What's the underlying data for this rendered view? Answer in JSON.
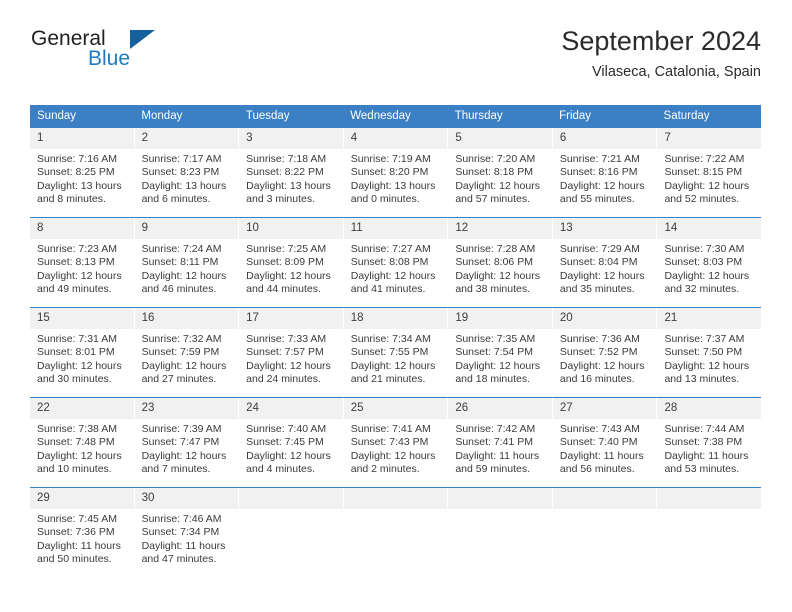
{
  "brand": {
    "name_top": "General",
    "name_bottom": "Blue",
    "accent_color": "#1d7cc4",
    "triangle_color": "#17609e",
    "logo_icon": "triangle-icon"
  },
  "header": {
    "title": "September 2024",
    "subtitle": "Vilaseca, Catalonia, Spain"
  },
  "calendar": {
    "header_bg_color": "#3b7fc4",
    "day_number_bg_color": "#f1f1f1",
    "weekdays": [
      "Sunday",
      "Monday",
      "Tuesday",
      "Wednesday",
      "Thursday",
      "Friday",
      "Saturday"
    ],
    "weeks": [
      [
        {
          "date": "1",
          "sunrise": "Sunrise: 7:16 AM",
          "sunset": "Sunset: 8:25 PM",
          "daylight_line1": "Daylight: 13 hours",
          "daylight_line2": "and 8 minutes."
        },
        {
          "date": "2",
          "sunrise": "Sunrise: 7:17 AM",
          "sunset": "Sunset: 8:23 PM",
          "daylight_line1": "Daylight: 13 hours",
          "daylight_line2": "and 6 minutes."
        },
        {
          "date": "3",
          "sunrise": "Sunrise: 7:18 AM",
          "sunset": "Sunset: 8:22 PM",
          "daylight_line1": "Daylight: 13 hours",
          "daylight_line2": "and 3 minutes."
        },
        {
          "date": "4",
          "sunrise": "Sunrise: 7:19 AM",
          "sunset": "Sunset: 8:20 PM",
          "daylight_line1": "Daylight: 13 hours",
          "daylight_line2": "and 0 minutes."
        },
        {
          "date": "5",
          "sunrise": "Sunrise: 7:20 AM",
          "sunset": "Sunset: 8:18 PM",
          "daylight_line1": "Daylight: 12 hours",
          "daylight_line2": "and 57 minutes."
        },
        {
          "date": "6",
          "sunrise": "Sunrise: 7:21 AM",
          "sunset": "Sunset: 8:16 PM",
          "daylight_line1": "Daylight: 12 hours",
          "daylight_line2": "and 55 minutes."
        },
        {
          "date": "7",
          "sunrise": "Sunrise: 7:22 AM",
          "sunset": "Sunset: 8:15 PM",
          "daylight_line1": "Daylight: 12 hours",
          "daylight_line2": "and 52 minutes."
        }
      ],
      [
        {
          "date": "8",
          "sunrise": "Sunrise: 7:23 AM",
          "sunset": "Sunset: 8:13 PM",
          "daylight_line1": "Daylight: 12 hours",
          "daylight_line2": "and 49 minutes."
        },
        {
          "date": "9",
          "sunrise": "Sunrise: 7:24 AM",
          "sunset": "Sunset: 8:11 PM",
          "daylight_line1": "Daylight: 12 hours",
          "daylight_line2": "and 46 minutes."
        },
        {
          "date": "10",
          "sunrise": "Sunrise: 7:25 AM",
          "sunset": "Sunset: 8:09 PM",
          "daylight_line1": "Daylight: 12 hours",
          "daylight_line2": "and 44 minutes."
        },
        {
          "date": "11",
          "sunrise": "Sunrise: 7:27 AM",
          "sunset": "Sunset: 8:08 PM",
          "daylight_line1": "Daylight: 12 hours",
          "daylight_line2": "and 41 minutes."
        },
        {
          "date": "12",
          "sunrise": "Sunrise: 7:28 AM",
          "sunset": "Sunset: 8:06 PM",
          "daylight_line1": "Daylight: 12 hours",
          "daylight_line2": "and 38 minutes."
        },
        {
          "date": "13",
          "sunrise": "Sunrise: 7:29 AM",
          "sunset": "Sunset: 8:04 PM",
          "daylight_line1": "Daylight: 12 hours",
          "daylight_line2": "and 35 minutes."
        },
        {
          "date": "14",
          "sunrise": "Sunrise: 7:30 AM",
          "sunset": "Sunset: 8:03 PM",
          "daylight_line1": "Daylight: 12 hours",
          "daylight_line2": "and 32 minutes."
        }
      ],
      [
        {
          "date": "15",
          "sunrise": "Sunrise: 7:31 AM",
          "sunset": "Sunset: 8:01 PM",
          "daylight_line1": "Daylight: 12 hours",
          "daylight_line2": "and 30 minutes."
        },
        {
          "date": "16",
          "sunrise": "Sunrise: 7:32 AM",
          "sunset": "Sunset: 7:59 PM",
          "daylight_line1": "Daylight: 12 hours",
          "daylight_line2": "and 27 minutes."
        },
        {
          "date": "17",
          "sunrise": "Sunrise: 7:33 AM",
          "sunset": "Sunset: 7:57 PM",
          "daylight_line1": "Daylight: 12 hours",
          "daylight_line2": "and 24 minutes."
        },
        {
          "date": "18",
          "sunrise": "Sunrise: 7:34 AM",
          "sunset": "Sunset: 7:55 PM",
          "daylight_line1": "Daylight: 12 hours",
          "daylight_line2": "and 21 minutes."
        },
        {
          "date": "19",
          "sunrise": "Sunrise: 7:35 AM",
          "sunset": "Sunset: 7:54 PM",
          "daylight_line1": "Daylight: 12 hours",
          "daylight_line2": "and 18 minutes."
        },
        {
          "date": "20",
          "sunrise": "Sunrise: 7:36 AM",
          "sunset": "Sunset: 7:52 PM",
          "daylight_line1": "Daylight: 12 hours",
          "daylight_line2": "and 16 minutes."
        },
        {
          "date": "21",
          "sunrise": "Sunrise: 7:37 AM",
          "sunset": "Sunset: 7:50 PM",
          "daylight_line1": "Daylight: 12 hours",
          "daylight_line2": "and 13 minutes."
        }
      ],
      [
        {
          "date": "22",
          "sunrise": "Sunrise: 7:38 AM",
          "sunset": "Sunset: 7:48 PM",
          "daylight_line1": "Daylight: 12 hours",
          "daylight_line2": "and 10 minutes."
        },
        {
          "date": "23",
          "sunrise": "Sunrise: 7:39 AM",
          "sunset": "Sunset: 7:47 PM",
          "daylight_line1": "Daylight: 12 hours",
          "daylight_line2": "and 7 minutes."
        },
        {
          "date": "24",
          "sunrise": "Sunrise: 7:40 AM",
          "sunset": "Sunset: 7:45 PM",
          "daylight_line1": "Daylight: 12 hours",
          "daylight_line2": "and 4 minutes."
        },
        {
          "date": "25",
          "sunrise": "Sunrise: 7:41 AM",
          "sunset": "Sunset: 7:43 PM",
          "daylight_line1": "Daylight: 12 hours",
          "daylight_line2": "and 2 minutes."
        },
        {
          "date": "26",
          "sunrise": "Sunrise: 7:42 AM",
          "sunset": "Sunset: 7:41 PM",
          "daylight_line1": "Daylight: 11 hours",
          "daylight_line2": "and 59 minutes."
        },
        {
          "date": "27",
          "sunrise": "Sunrise: 7:43 AM",
          "sunset": "Sunset: 7:40 PM",
          "daylight_line1": "Daylight: 11 hours",
          "daylight_line2": "and 56 minutes."
        },
        {
          "date": "28",
          "sunrise": "Sunrise: 7:44 AM",
          "sunset": "Sunset: 7:38 PM",
          "daylight_line1": "Daylight: 11 hours",
          "daylight_line2": "and 53 minutes."
        }
      ],
      [
        {
          "date": "29",
          "sunrise": "Sunrise: 7:45 AM",
          "sunset": "Sunset: 7:36 PM",
          "daylight_line1": "Daylight: 11 hours",
          "daylight_line2": "and 50 minutes."
        },
        {
          "date": "30",
          "sunrise": "Sunrise: 7:46 AM",
          "sunset": "Sunset: 7:34 PM",
          "daylight_line1": "Daylight: 11 hours",
          "daylight_line2": "and 47 minutes."
        },
        {
          "date": "",
          "sunrise": "",
          "sunset": "",
          "daylight_line1": "",
          "daylight_line2": ""
        },
        {
          "date": "",
          "sunrise": "",
          "sunset": "",
          "daylight_line1": "",
          "daylight_line2": ""
        },
        {
          "date": "",
          "sunrise": "",
          "sunset": "",
          "daylight_line1": "",
          "daylight_line2": ""
        },
        {
          "date": "",
          "sunrise": "",
          "sunset": "",
          "daylight_line1": "",
          "daylight_line2": ""
        },
        {
          "date": "",
          "sunrise": "",
          "sunset": "",
          "daylight_line1": "",
          "daylight_line2": ""
        }
      ]
    ]
  }
}
